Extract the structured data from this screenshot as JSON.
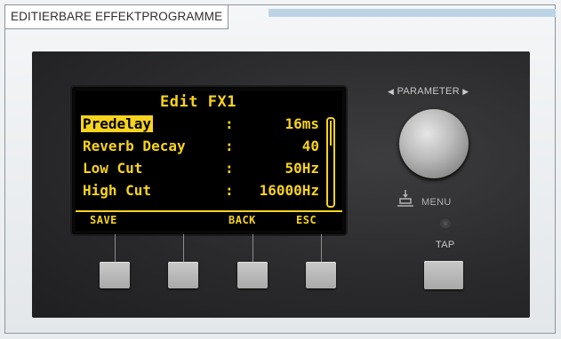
{
  "caption": "EDITIERBARE EFFEKTPROGRAMME",
  "screen": {
    "title": "Edit FX1",
    "rows": [
      {
        "name": "Predelay",
        "colon": ":",
        "value": "16ms"
      },
      {
        "name": "Reverb Decay",
        "colon": ":",
        "value": "40"
      },
      {
        "name": "Low Cut",
        "colon": ":",
        "value": "50Hz"
      },
      {
        "name": "High Cut",
        "colon": ":",
        "value": "16000Hz"
      }
    ],
    "selected_row": 0,
    "softkeys": [
      "SAVE",
      "",
      "BACK",
      "ESC"
    ]
  },
  "controls": {
    "parameter_label": "PARAMETER",
    "menu_label": "MENU",
    "tap_label": "TAP"
  },
  "colors": {
    "lcd_text": "#f7d31e",
    "lcd_background": "#000000",
    "panel": "#2a2a2c",
    "caption_bar": "#bcd3e6"
  },
  "icons": [
    "arrow-left-icon",
    "arrow-right-icon",
    "menu-push-icon",
    "tap-led-icon"
  ]
}
